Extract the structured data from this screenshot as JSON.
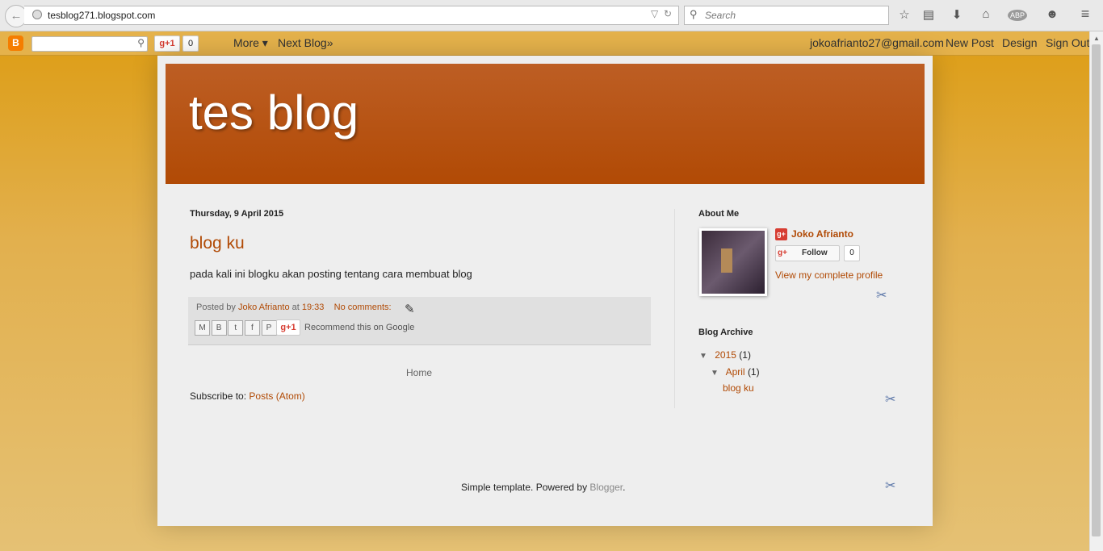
{
  "browser": {
    "url": "tesblog271.blogspot.com",
    "search_placeholder": "Search",
    "abp_label": "ABP"
  },
  "navbar": {
    "gplus_label": "g+1",
    "gplus_count": "0",
    "more_label": "More ▾",
    "next_blog_label": "Next Blog»",
    "email": "jokoafrianto27@gmail.com",
    "new_post_label": "New Post",
    "design_label": "Design",
    "sign_out_label": "Sign Out"
  },
  "blog": {
    "title": "tes blog"
  },
  "post": {
    "date": "Thursday, 9 April 2015",
    "title": "blog ku",
    "body": "pada kali ini blogku akan posting tentang cara membuat blog",
    "posted_by_label": "Posted by",
    "author": "Joko Afrianto",
    "at_label": "at",
    "time": "19:33",
    "comments": "No comments:",
    "gplus_label": "g+1",
    "recommend": "Recommend this on Google"
  },
  "main": {
    "home_label": "Home",
    "subscribe_label": "Subscribe to:",
    "subscribe_link": "Posts (Atom)"
  },
  "sidebar": {
    "about_heading": "About Me",
    "profile_name": "Joko Afrianto",
    "follow_label": "Follow",
    "follow_count": "0",
    "view_profile": "View my complete profile",
    "archive_heading": "Blog Archive",
    "archive_year": "2015",
    "archive_year_count": "(1)",
    "archive_month": "April",
    "archive_month_count": "(1)",
    "archive_post": "blog ku"
  },
  "footer": {
    "powered_text": "Simple template. Powered by",
    "powered_link": "Blogger",
    "powered_suffix": "."
  }
}
